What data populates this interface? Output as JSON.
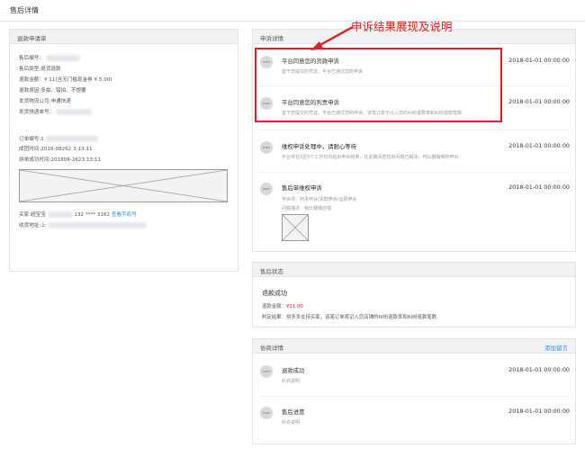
{
  "page": {
    "title": "售后详情"
  },
  "annotation": {
    "text": "申诉结果展现及说明",
    "color": "#e02020"
  },
  "left_panel": {
    "heading": "退款申请单",
    "fields": {
      "after_sale_no": "售后编号：",
      "after_sale_type": "售后类型:退货退款",
      "refund_amount": "退款金额：¥ 11(含无门槛现金券 ¥ 5.00)",
      "refund_reason": "退款原因:多拍、错拍、不想要",
      "logistics_company": "发货物流公司:申通快递",
      "tracking_no": "发货快递单号：",
      "order_no": "订单编号:1",
      "deal_time": "成团时间:2018-08262 3:13:11",
      "success_time": "拼单成功时间:201808-2623:13:11",
      "buyer_label": "买家:超宝宝",
      "buyer_phone": "132 **** 3162",
      "view_phone": "查看手机号",
      "shipping_address": "收货地址:上"
    }
  },
  "complaint_panel": {
    "heading": "申诉详情",
    "entries": [
      {
        "avatar": "icon",
        "title": "平台同意您的货款申诉",
        "time": "2018-01-01 00:00:00",
        "desc": "鉴于您提交的凭证，平台已通过您的申诉"
      },
      {
        "avatar": "icon",
        "title": "平台同意您的判责申诉",
        "time": "2018-01-01 00:00:00",
        "desc": "鉴于您提交的凭证，平台已通过您的申诉，该笔订单不计入您的纠纷退款率和纠纷退款笔数"
      },
      {
        "avatar": "icon",
        "title": "维权申诉处理中，请耐心等待",
        "time": "2018-01-01 00:00:00",
        "desc": "平台将在2至5个工作日内给出申诉结果，在此期间若您的问题已解决，可以撤销维权申诉"
      },
      {
        "avatar": "icon",
        "title": "售后单维权申诉",
        "time": "2018-01-01 00:00:00",
        "desc": "申诉项：判责申诉/货款申诉/运费申诉",
        "desc2": "问题描述：我比赛撸还嘿"
      }
    ]
  },
  "status_panel": {
    "heading": "售后状态",
    "status": "退款成功",
    "amount_label": "退款金额：",
    "amount_value": "¥11.00",
    "result": "判定结果：拼多多支持买家，该笔订单将记入您店铺的纠纷退款率和纠纷退款笔数"
  },
  "assist_panel": {
    "heading": "协商详情",
    "add_message": "添加留言",
    "entries": [
      {
        "avatar": "icon",
        "title": "退款成功",
        "time": "2018-01-01 00:00:00",
        "desc": "补充说明"
      },
      {
        "avatar": "icon",
        "title": "售后进度",
        "time": "2018-01-01 00:00:00",
        "desc": "补充说明"
      }
    ]
  }
}
